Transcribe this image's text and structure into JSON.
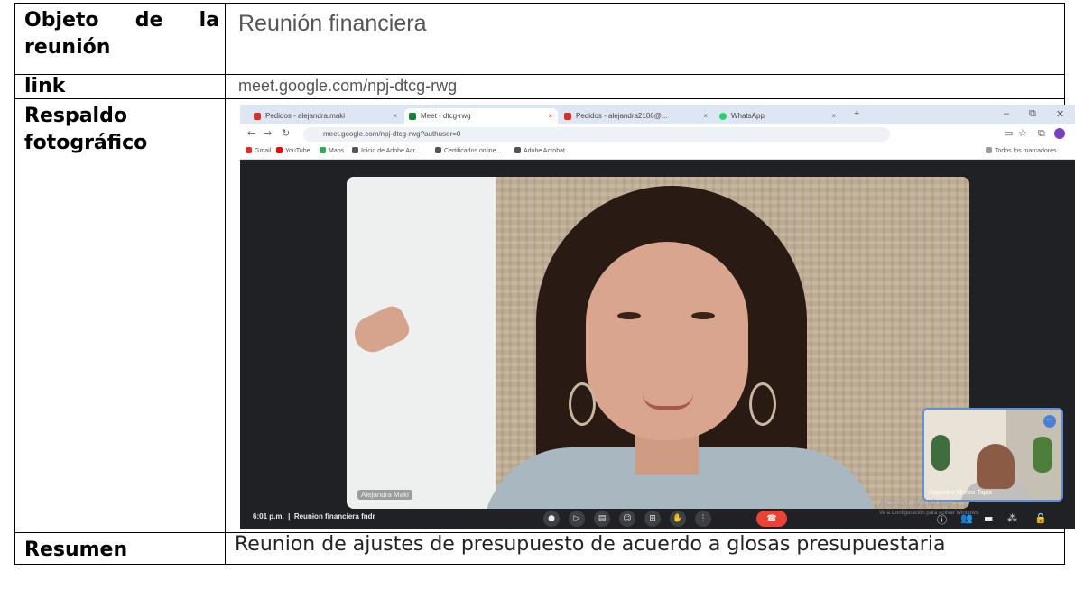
{
  "table": {
    "rows": [
      {
        "label_words": [
          "Objeto",
          "de",
          "la"
        ],
        "label_line2": "reunión",
        "value": "Reunión financiera"
      },
      {
        "label": "link",
        "value": "meet.google.com/npj-dtcg-rwg"
      },
      {
        "label_line1": "Respaldo",
        "label_line2": "fotográfico"
      },
      {
        "label": "Resumen",
        "value": "Reunion de ajustes de presupuesto  de acuerdo a glosas presupuestaria"
      }
    ]
  },
  "screenshot": {
    "tabs": [
      {
        "label": "Pedidos - alejandra.maki",
        "color": "#d93025"
      },
      {
        "label": "Meet - dtcg-rwg",
        "color": "#188038"
      },
      {
        "label": "Pedidos - alejandra2106@...",
        "color": "#d93025"
      },
      {
        "label": "WhatsApp",
        "color": "#25d366"
      }
    ],
    "address": "meet.google.com/npj-dtcg-rwg?authuser=0",
    "bookmarks": [
      "Gmail",
      "YouTube",
      "Maps",
      "Inicio de Adobe Acr...",
      "Certificados online...",
      "Adobe Acrobat"
    ],
    "bookmarks_right": "Todos los marcadores",
    "main_participant_label": "Alejandra Maki",
    "pip_participant_label": "Alejandro Muñoz Tapia",
    "clock": "6:01 p.m.",
    "meeting_name": "Reunion financiera fndr",
    "activate_title": "Activar Windows",
    "activate_sub": "Ve a Configuración para activar Windows.",
    "colors": {
      "end_call": "#ea4335",
      "meet_bg": "#202124"
    }
  }
}
